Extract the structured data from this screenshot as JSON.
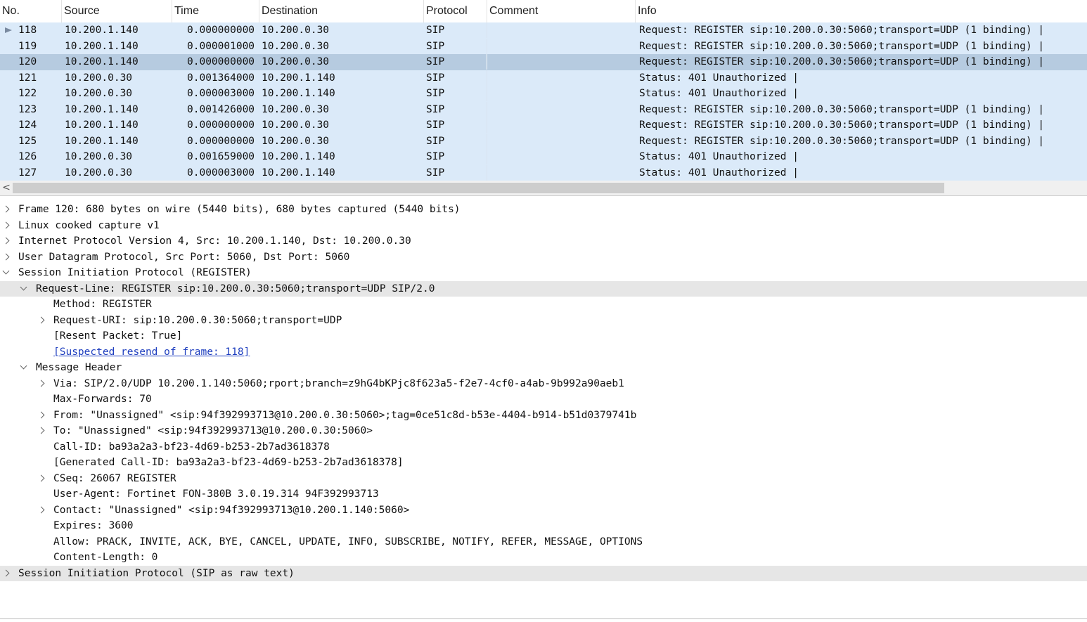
{
  "columns": [
    "No.",
    "Source",
    "Time",
    "Destination",
    "Protocol",
    "Comment",
    "Info"
  ],
  "packets": [
    {
      "no": "118",
      "source": "10.200.1.140",
      "time": "0.000000000",
      "destination": "10.200.0.30",
      "protocol": "SIP",
      "comment": "",
      "info": "Request: REGISTER sip:10.200.0.30:5060;transport=UDP  (1 binding) |"
    },
    {
      "no": "119",
      "source": "10.200.1.140",
      "time": "0.000001000",
      "destination": "10.200.0.30",
      "protocol": "SIP",
      "comment": "",
      "info": "Request: REGISTER sip:10.200.0.30:5060;transport=UDP  (1 binding) |"
    },
    {
      "no": "120",
      "source": "10.200.1.140",
      "time": "0.000000000",
      "destination": "10.200.0.30",
      "protocol": "SIP",
      "comment": "",
      "info": "Request: REGISTER sip:10.200.0.30:5060;transport=UDP  (1 binding) |"
    },
    {
      "no": "121",
      "source": "10.200.0.30",
      "time": "0.001364000",
      "destination": "10.200.1.140",
      "protocol": "SIP",
      "comment": "",
      "info": "Status: 401 Unauthorized |"
    },
    {
      "no": "122",
      "source": "10.200.0.30",
      "time": "0.000003000",
      "destination": "10.200.1.140",
      "protocol": "SIP",
      "comment": "",
      "info": "Status: 401 Unauthorized |"
    },
    {
      "no": "123",
      "source": "10.200.1.140",
      "time": "0.001426000",
      "destination": "10.200.0.30",
      "protocol": "SIP",
      "comment": "",
      "info": "Request: REGISTER sip:10.200.0.30:5060;transport=UDP  (1 binding) |"
    },
    {
      "no": "124",
      "source": "10.200.1.140",
      "time": "0.000000000",
      "destination": "10.200.0.30",
      "protocol": "SIP",
      "comment": "",
      "info": "Request: REGISTER sip:10.200.0.30:5060;transport=UDP  (1 binding) |"
    },
    {
      "no": "125",
      "source": "10.200.1.140",
      "time": "0.000000000",
      "destination": "10.200.0.30",
      "protocol": "SIP",
      "comment": "",
      "info": "Request: REGISTER sip:10.200.0.30:5060;transport=UDP  (1 binding) |"
    },
    {
      "no": "126",
      "source": "10.200.0.30",
      "time": "0.001659000",
      "destination": "10.200.1.140",
      "protocol": "SIP",
      "comment": "",
      "info": "Status: 401 Unauthorized |"
    },
    {
      "no": "127",
      "source": "10.200.0.30",
      "time": "0.000003000",
      "destination": "10.200.1.140",
      "protocol": "SIP",
      "comment": "",
      "info": "Status: 401 Unauthorized |"
    }
  ],
  "selected_packet": "120",
  "scroll_left_glyph": "<",
  "details": [
    {
      "text": "Frame 120: 680 bytes on wire (5440 bits), 680 bytes captured (5440 bits)",
      "toggle": "collapsed",
      "level": 0
    },
    {
      "text": "Linux cooked capture v1",
      "toggle": "collapsed",
      "level": 0
    },
    {
      "text": "Internet Protocol Version 4, Src: 10.200.1.140, Dst: 10.200.0.30",
      "toggle": "collapsed",
      "level": 0
    },
    {
      "text": "User Datagram Protocol, Src Port: 5060, Dst Port: 5060",
      "toggle": "collapsed",
      "level": 0
    },
    {
      "text": "Session Initiation Protocol (REGISTER)",
      "toggle": "expanded",
      "level": 0
    },
    {
      "text": "Request-Line: REGISTER sip:10.200.0.30:5060;transport=UDP SIP/2.0",
      "toggle": "expanded",
      "level": 1,
      "highlight": true
    },
    {
      "text": "Method: REGISTER",
      "toggle": "none",
      "level": 2
    },
    {
      "text": "Request-URI: sip:10.200.0.30:5060;transport=UDP",
      "toggle": "collapsed",
      "level": 2
    },
    {
      "text": "[Resent Packet: True]",
      "toggle": "none",
      "level": 2
    },
    {
      "text": "[Suspected resend of frame: 118]",
      "toggle": "none",
      "level": 2,
      "link": true
    },
    {
      "text": "Message Header",
      "toggle": "expanded",
      "level": 1
    },
    {
      "text": "Via: SIP/2.0/UDP 10.200.1.140:5060;rport;branch=z9hG4bKPjc8f623a5-f2e7-4cf0-a4ab-9b992a90aeb1",
      "toggle": "collapsed",
      "level": 2
    },
    {
      "text": "Max-Forwards: 70",
      "toggle": "none",
      "level": 2
    },
    {
      "text": "From: \"Unassigned\" <sip:94f392993713@10.200.0.30:5060>;tag=0ce51c8d-b53e-4404-b914-b51d0379741b",
      "toggle": "collapsed",
      "level": 2
    },
    {
      "text": "To: \"Unassigned\" <sip:94f392993713@10.200.0.30:5060>",
      "toggle": "collapsed",
      "level": 2
    },
    {
      "text": "Call-ID: ba93a2a3-bf23-4d69-b253-2b7ad3618378",
      "toggle": "none",
      "level": 2
    },
    {
      "text": "[Generated Call-ID: ba93a2a3-bf23-4d69-b253-2b7ad3618378]",
      "toggle": "none",
      "level": 2
    },
    {
      "text": "CSeq: 26067 REGISTER",
      "toggle": "collapsed",
      "level": 2
    },
    {
      "text": "User-Agent: Fortinet FON-380B 3.0.19.314 94F392993713",
      "toggle": "none",
      "level": 2
    },
    {
      "text": "Contact: \"Unassigned\" <sip:94f392993713@10.200.1.140:5060>",
      "toggle": "collapsed",
      "level": 2
    },
    {
      "text": "Expires: 3600",
      "toggle": "none",
      "level": 2
    },
    {
      "text": "Allow: PRACK, INVITE, ACK, BYE, CANCEL, UPDATE, INFO, SUBSCRIBE, NOTIFY, REFER, MESSAGE, OPTIONS",
      "toggle": "none",
      "level": 2
    },
    {
      "text": "Content-Length:  0",
      "toggle": "none",
      "level": 2
    },
    {
      "text": "Session Initiation Protocol (SIP as raw text)",
      "toggle": "collapsed",
      "level": 0,
      "highlight": true
    }
  ],
  "colors": {
    "row_bg": "#dbeaf9",
    "selected_row_bg": "#b6cbe0",
    "detail_highlight": "#e6e6e6",
    "link": "#1f3fbf"
  }
}
